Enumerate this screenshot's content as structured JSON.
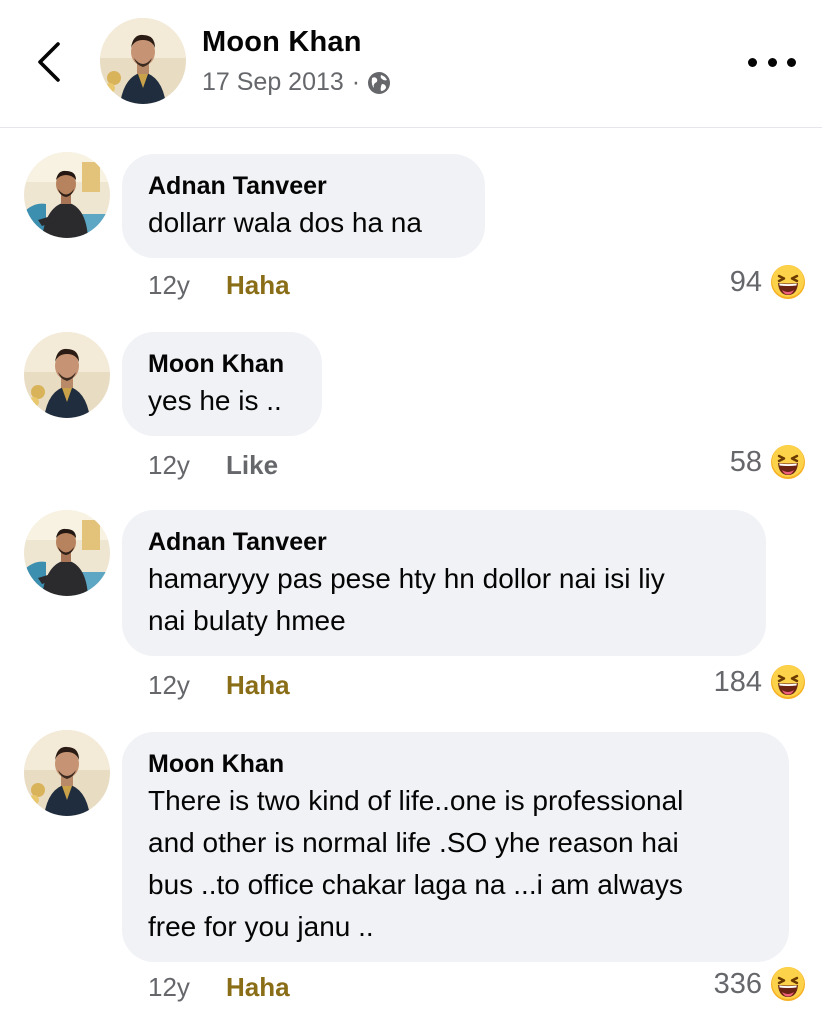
{
  "header": {
    "name": "Moon Khan",
    "date": "17 Sep 2013",
    "separator": "·",
    "privacy_icon": "globe-icon"
  },
  "comments": [
    {
      "author": "Adnan Tanveer",
      "lines": [
        "dollarr wala dos ha na"
      ],
      "time": "12y",
      "action": "Haha",
      "reaction_count": "94",
      "reaction_icon": "haha-emoji-icon"
    },
    {
      "author": "Moon Khan",
      "lines": [
        "yes he is .."
      ],
      "time": "12y",
      "action": "Like",
      "reaction_count": "58",
      "reaction_icon": "haha-emoji-icon"
    },
    {
      "author": "Adnan Tanveer",
      "lines": [
        "hamaryyy pas pese hty hn dollor nai isi liy",
        "nai bulaty hmee"
      ],
      "time": "12y",
      "action": "Haha",
      "reaction_count": "184",
      "reaction_icon": "haha-emoji-icon"
    },
    {
      "author": "Moon Khan",
      "lines": [
        "There is two kind of life..one is professional",
        "and other is normal life .SO yhe reason hai",
        "bus ..to office chakar laga na ...i am always",
        "free for you janu .."
      ],
      "time": "12y",
      "action": "Haha",
      "reaction_count": "336",
      "reaction_icon": "haha-emoji-icon"
    }
  ],
  "colors": {
    "bubble": "#f0f2f5",
    "meta": "#65676b",
    "haha_action": "#8a6d17",
    "emoji_face": "#f7b125",
    "divider": "#e4e6eb"
  }
}
